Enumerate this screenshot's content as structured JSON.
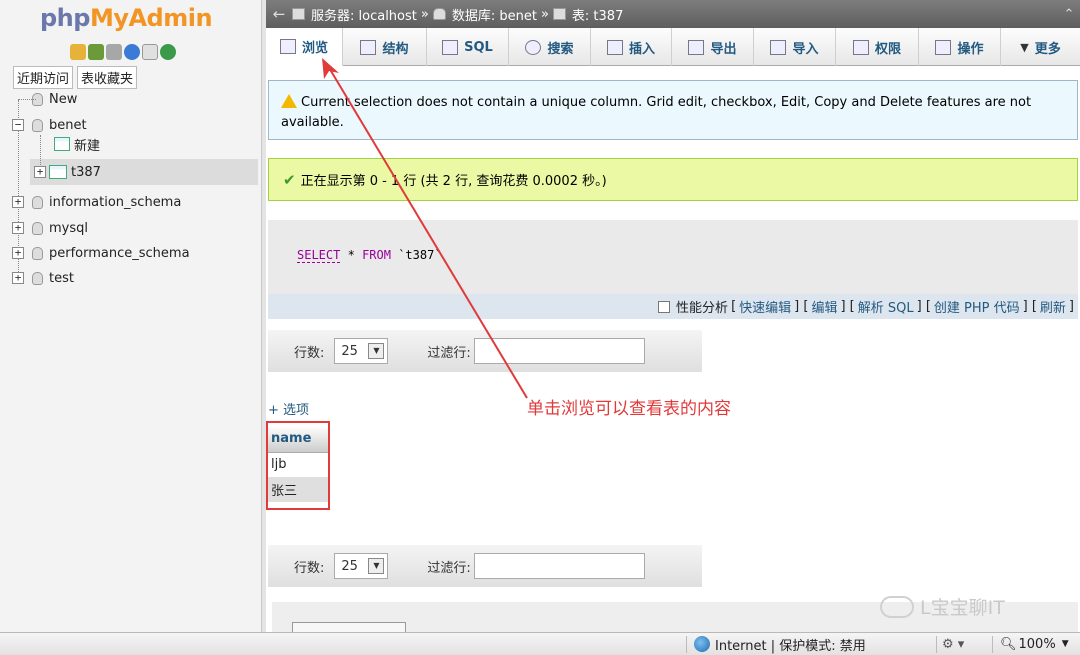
{
  "nav": {
    "logo_part1": "php",
    "logo_part2": "MyAdmin",
    "tabs": [
      "近期访问",
      "表收藏夹"
    ],
    "tree": {
      "new": "New",
      "db_benet": "benet",
      "new_table": "新建",
      "table_t387": "t387",
      "db_information_schema": "information_schema",
      "db_mysql": "mysql",
      "db_performance_schema": "performance_schema",
      "db_test": "test"
    },
    "icons": [
      "home-icon",
      "exit-icon",
      "sql-query-icon",
      "help-icon",
      "docs-icon",
      "reload-icon"
    ]
  },
  "topbar": {
    "back": "←",
    "server_label": "服务器: localhost",
    "database_label": "数据库: benet",
    "table_label": "表: t387",
    "sep": "»",
    "collapse": "⌃"
  },
  "tabs": [
    {
      "label": "浏览",
      "icon": "browse-icon"
    },
    {
      "label": "结构",
      "icon": "structure-icon"
    },
    {
      "label": "SQL",
      "icon": "sql-icon"
    },
    {
      "label": "搜索",
      "icon": "search-icon"
    },
    {
      "label": "插入",
      "icon": "insert-icon"
    },
    {
      "label": "导出",
      "icon": "export-icon"
    },
    {
      "label": "导入",
      "icon": "import-icon"
    },
    {
      "label": "权限",
      "icon": "privileges-icon"
    },
    {
      "label": "操作",
      "icon": "operations-icon"
    },
    {
      "label": "更多",
      "icon": "more-icon"
    }
  ],
  "notice": {
    "text": "Current selection does not contain a unique column. Grid edit, checkbox, Edit, Copy and Delete features are not available."
  },
  "success": {
    "text": "正在显示第 0 - 1 行 (共 2 行, 查询花费 0.0002 秒。)"
  },
  "sql": {
    "select": "SELECT",
    "star": "*",
    "from": "FROM",
    "table": "`t387`"
  },
  "sql_options": {
    "profiling": "性能分析",
    "links": [
      "快速编辑",
      "编辑",
      "解析 SQL",
      "创建 PHP 代码",
      "刷新"
    ]
  },
  "navbar": {
    "rows_label": "行数:",
    "rows_value": "25",
    "filter_label": "过滤行:",
    "filter_value": ""
  },
  "options_link": "+ 选项",
  "results": {
    "column": "name",
    "rows": [
      "ljb",
      "张三"
    ]
  },
  "annotation": "单击浏览可以查看表的内容",
  "watermark": "L宝宝聊IT",
  "statusbar": {
    "zone": "Internet | 保护模式: 禁用",
    "zoom": "100%"
  }
}
